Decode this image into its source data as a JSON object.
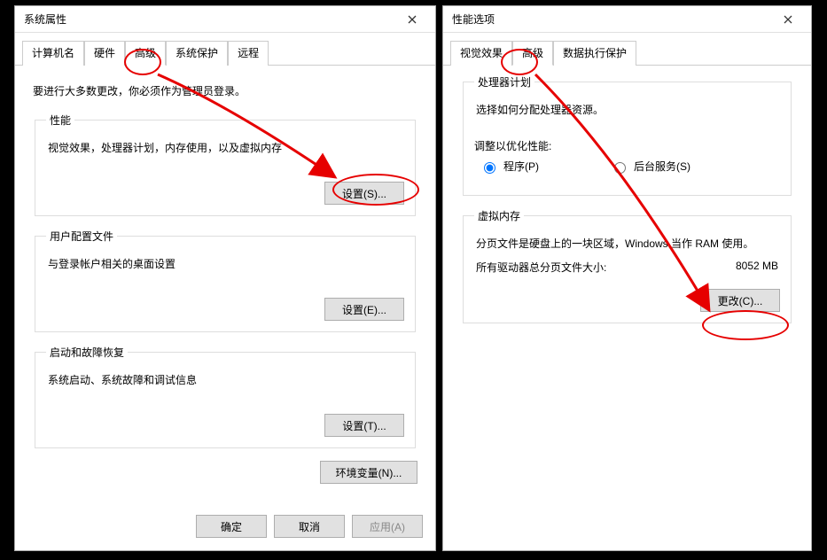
{
  "left": {
    "title": "系统属性",
    "tabs": [
      "计算机名",
      "硬件",
      "高级",
      "系统保护",
      "远程"
    ],
    "active_tab_index": 2,
    "intro": "要进行大多数更改，你必须作为管理员登录。",
    "groups": {
      "perf": {
        "legend": "性能",
        "desc": "视觉效果，处理器计划，内存使用，以及虚拟内存",
        "button": "设置(S)..."
      },
      "profile": {
        "legend": "用户配置文件",
        "desc": "与登录帐户相关的桌面设置",
        "button": "设置(E)..."
      },
      "startup": {
        "legend": "启动和故障恢复",
        "desc": "系统启动、系统故障和调试信息",
        "button": "设置(T)..."
      }
    },
    "env_button": "环境变量(N)...",
    "footer": {
      "ok": "确定",
      "cancel": "取消",
      "apply": "应用(A)"
    }
  },
  "right": {
    "title": "性能选项",
    "tabs": [
      "视觉效果",
      "高级",
      "数据执行保护"
    ],
    "active_tab_index": 1,
    "cpu": {
      "legend": "处理器计划",
      "desc": "选择如何分配处理器资源。",
      "adjust_label": "调整以优化性能:",
      "radio_programs": "程序(P)",
      "radio_background": "后台服务(S)",
      "selected": "programs"
    },
    "vm": {
      "legend": "虚拟内存",
      "desc": "分页文件是硬盘上的一块区域，Windows 当作 RAM 使用。",
      "total_label": "所有驱动器总分页文件大小:",
      "total_value": "8052 MB",
      "change_button": "更改(C)..."
    }
  }
}
